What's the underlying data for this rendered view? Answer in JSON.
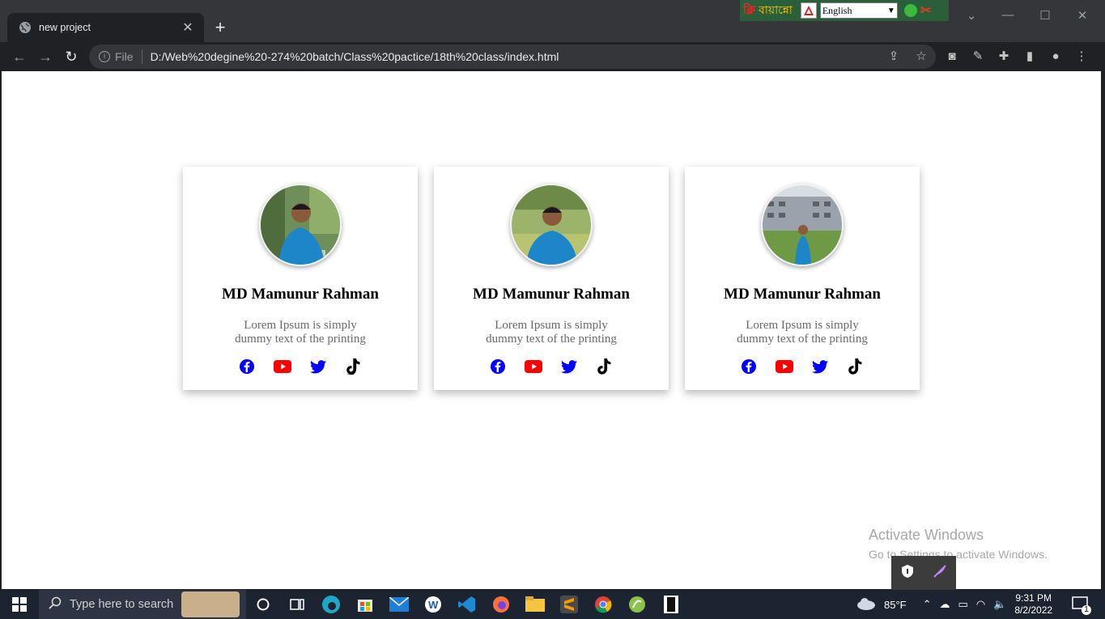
{
  "browser": {
    "tab_title": "new project",
    "file_label": "File",
    "url": "D:/Web%20degine%20-274%20batch/Class%20pactice/18th%20class/index.html"
  },
  "extension_bar": {
    "brand_text": "বায়ান্নো",
    "language": "English"
  },
  "cards": [
    {
      "name": "MD Mamunur Rahman",
      "desc": "Lorem Ipsum is simply dummy text of the printing",
      "photo_bg": "#6f8f5a"
    },
    {
      "name": "MD Mamunur Rahman",
      "desc": "Lorem Ipsum is simply dummy text of the printing",
      "photo_bg": "#9bb36a"
    },
    {
      "name": "MD Mamunur Rahman",
      "desc": "Lorem Ipsum is simply dummy text of the printing",
      "photo_bg": "#8a9aa8"
    }
  ],
  "social_icons": [
    "facebook-icon",
    "youtube-icon",
    "twitter-icon",
    "tiktok-icon"
  ],
  "colors": {
    "facebook": "#0000ff",
    "youtube": "#ff0000",
    "twitter": "#0000ff",
    "tiktok": "#000000",
    "shirt": "#1c86c8"
  },
  "watermark": {
    "line1": "Activate Windows",
    "line2": "Go to Settings to activate Windows."
  },
  "taskbar": {
    "search_placeholder": "Type here to search",
    "weather": "85°F",
    "time": "9:31 PM",
    "date": "8/2/2022",
    "notifications": "1"
  }
}
